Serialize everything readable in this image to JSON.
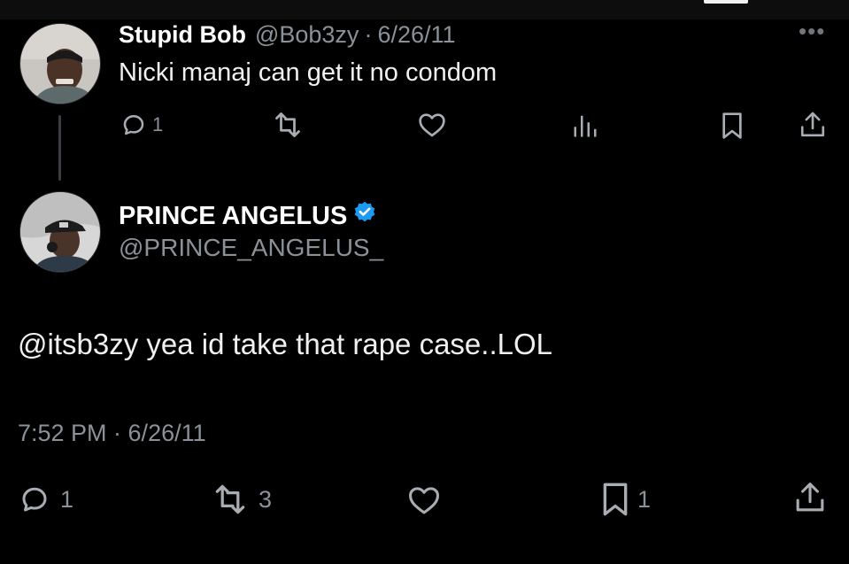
{
  "reply_tweet": {
    "display_name": "Stupid Bob",
    "handle": "@Bob3zy",
    "separator": "·",
    "date": "6/26/11",
    "text": "Nicki manaj can get it no condom",
    "more_icon": "more-horizontal-icon",
    "actions": {
      "reply_count": "1",
      "retweet_count": "",
      "like_count": "",
      "views_count": "",
      "bookmark_count": "",
      "share_count": ""
    }
  },
  "main_tweet": {
    "display_name": "PRINCE ANGELUS",
    "handle": "@PRINCE_ANGELUS_",
    "verified_icon": "verified-badge-icon",
    "text": "@itsb3zy yea id take that rape case..LOL",
    "timestamp": "7:52 PM · 6/26/11",
    "actions": {
      "reply_count": "1",
      "retweet_count": "3",
      "like_count": "",
      "bookmark_count": "1",
      "share_count": ""
    }
  },
  "colors": {
    "background": "#000000",
    "primary_text": "#e7e9ea",
    "secondary_text": "#8b9198",
    "verified_blue": "#1d9bf0",
    "thread_line": "#3a3d41"
  }
}
